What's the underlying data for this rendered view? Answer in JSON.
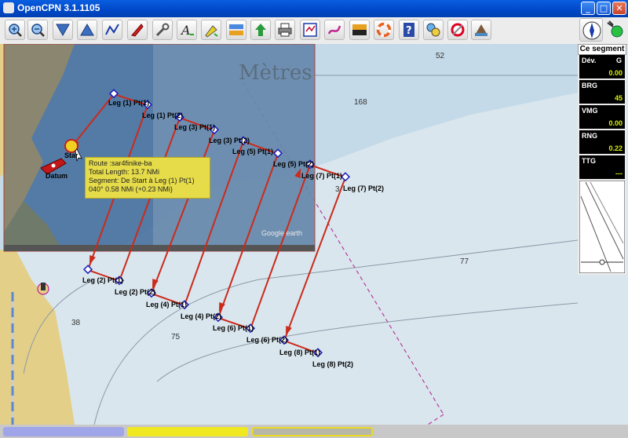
{
  "window": {
    "title": "OpenCPN 3.1.1105"
  },
  "toolbar": {
    "buttons": [
      {
        "icon": "zoom-in-icon"
      },
      {
        "icon": "zoom-out-icon"
      },
      {
        "icon": "scale-in-icon"
      },
      {
        "icon": "scale-out-icon"
      },
      {
        "icon": "route-icon"
      },
      {
        "icon": "follow-ship-icon"
      },
      {
        "icon": "settings-icon"
      },
      {
        "icon": "text-icon"
      },
      {
        "icon": "mark-icon"
      },
      {
        "icon": "tides-icon"
      },
      {
        "icon": "currents-icon"
      },
      {
        "icon": "print-icon"
      },
      {
        "icon": "route-manager-icon"
      },
      {
        "icon": "track-icon"
      },
      {
        "icon": "color-scheme-icon"
      },
      {
        "icon": "mob-icon"
      },
      {
        "icon": "help-icon"
      },
      {
        "icon": "plugin-icon"
      },
      {
        "icon": "plugin2-icon"
      },
      {
        "icon": "plugin3-icon"
      }
    ]
  },
  "dashboard": {
    "header": "Ce segment",
    "instruments": [
      {
        "label": "Dév.",
        "unit": "G",
        "value": "0.00"
      },
      {
        "label": "BRG",
        "unit": "",
        "value": "45"
      },
      {
        "label": "VMG",
        "unit": "",
        "value": "0.00"
      },
      {
        "label": "RNG",
        "unit": "",
        "value": "0.22"
      },
      {
        "label": "TTG",
        "unit": "",
        "value": "---"
      }
    ]
  },
  "chart": {
    "overlay_text": "Mètres",
    "google_text": "Google earth",
    "depths": [
      "52",
      "168",
      "77",
      "38",
      "75",
      "3"
    ],
    "boat_labels": [
      "Star",
      "Datum"
    ],
    "waypoints": [
      "Leg (1) Pt(1)",
      "Leg (1) Pt(2)",
      "Leg (2) Pt(1)",
      "Leg (2) Pt(2)",
      "Leg (3) Pt(1)",
      "Leg (3) Pt(2)",
      "Leg (4) Pt(1)",
      "Leg (4) Pt(2)",
      "Leg (5) Pt(1)",
      "Leg (5) Pt(2)",
      "Leg (6) Pt(1)",
      "Leg (6) Pt(2)",
      "Leg (7) Pt(1)",
      "Leg (7) Pt(2)",
      "Leg (8) Pt(1)",
      "Leg (8) Pt(2)"
    ]
  },
  "tooltip": {
    "route": "Route :sar4finike-ba",
    "length": "Total Length: 13.7 NMi",
    "segment": "Segment: De Start à Leg (1) Pt(1)",
    "bearing": "040°  0.58 NMi (+0.23 NMi)"
  },
  "colors": {
    "route": "#cc2a1a",
    "waypoint": "#1a1ab8",
    "tooltip": "#e6dc4a",
    "deepwater": "#d9e6ee",
    "shallow": "#bcd4e3",
    "land": "#e4cf88"
  }
}
